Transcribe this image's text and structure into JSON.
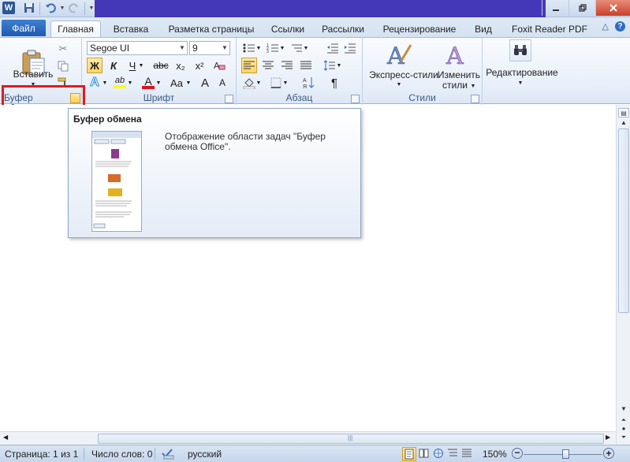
{
  "title_bar": {
    "app_icon": "W"
  },
  "tabs": {
    "file": "Файл",
    "items": [
      "Главная",
      "Вставка",
      "Разметка страницы",
      "Ссылки",
      "Рассылки",
      "Рецензирование",
      "Вид",
      "Foxit Reader PDF"
    ]
  },
  "ribbon": {
    "clipboard": {
      "paste_label": "Вставить",
      "group_label": "Буфер обмена"
    },
    "font": {
      "font_name": "Segoe UI",
      "font_size": "9",
      "group_label": "Шрифт",
      "bold": "Ж",
      "italic": "К",
      "underline": "Ч",
      "strike": "abc",
      "sub": "x₂",
      "sup": "x²",
      "text_a": "A",
      "grow": "A",
      "shrink": "A",
      "case": "Aa",
      "highlight": "ab"
    },
    "paragraph": {
      "group_label": "Абзац",
      "pilcrow": "¶"
    },
    "styles": {
      "express_label": "Экспресс-стили",
      "change_label_1": "Изменить",
      "change_label_2": "стили",
      "group_label": "Стили"
    },
    "editing": {
      "label": "Редактирование"
    }
  },
  "tooltip": {
    "title": "Буфер обмена",
    "description": "Отображение области задач \"Буфер обмена Office\"."
  },
  "status_bar": {
    "page": "Страница: 1 из 1",
    "words": "Число слов: 0",
    "language": "русский",
    "zoom": "150%"
  },
  "colors": {
    "accent": "#2b5797",
    "highlight_box": "#e01a22",
    "title_fill": "#4338b8"
  }
}
